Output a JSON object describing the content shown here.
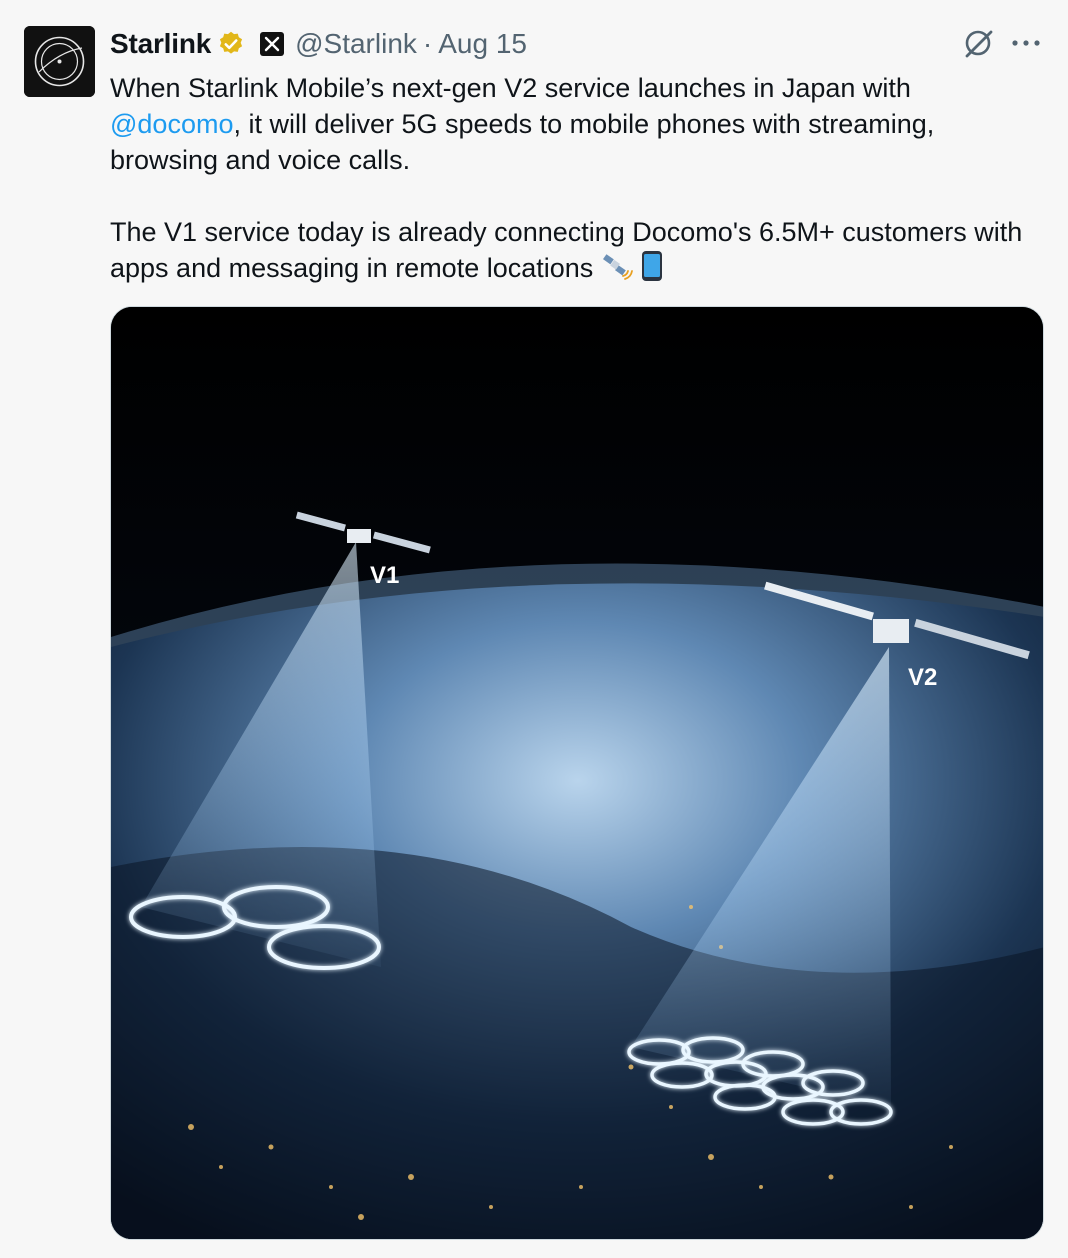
{
  "author": {
    "name": "Starlink",
    "handle": "@Starlink",
    "separator": "·",
    "date": "Aug 15"
  },
  "post": {
    "line1": "When Starlink Mobile’s next-gen V2 service launches in Japan with",
    "mention": "@docomo",
    "line2_rest": ", it will deliver 5G speeds to mobile phones with streaming, browsing and voice calls.",
    "paragraph2": "The V1 service today is already connecting Docomo's 6.5M+ customers with apps and messaging in remote locations"
  },
  "image": {
    "label_v1": "V1",
    "label_v2": "V2"
  },
  "icons": {
    "avatar": "starlink-logo-icon",
    "verified": "verified-badge-icon",
    "affiliation": "x-affiliate-icon",
    "grok": "grok-icon",
    "more": "more-icon",
    "satellite": "satellite-emoji-icon",
    "phone": "phone-emoji-icon"
  },
  "colors": {
    "mention": "#1d9bf0",
    "verified": "#e2b719",
    "muted": "#536471"
  }
}
